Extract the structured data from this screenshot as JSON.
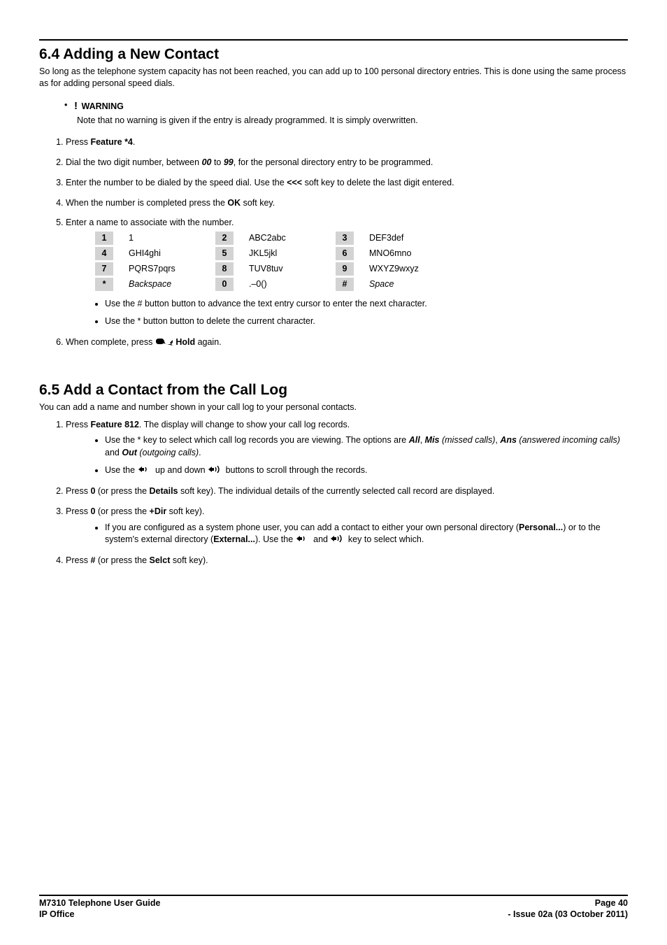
{
  "section64": {
    "heading": "6.4 Adding a New Contact",
    "intro": "So long as the telephone system capacity has not been reached, you can add up to 100 personal directory entries. This is done using the same process as for adding personal speed dials.",
    "warning_label": "WARNING",
    "warning_note": "Note that no warning is given if the entry is already programmed. It is simply overwritten.",
    "step1_a": "Press ",
    "step1_b": "Feature *4",
    "step1_c": ".",
    "step2_a": "Dial the two digit number, between ",
    "step2_b": "00",
    "step2_c": " to ",
    "step2_d": "99",
    "step2_e": ", for the personal directory entry to be programmed.",
    "step3_a": "Enter the number to be dialed by the speed dial.  Use the ",
    "step3_b": "<<<",
    "step3_c": " soft key to delete the last digit entered.",
    "step4_a": "When the number is completed press the ",
    "step4_b": "OK",
    "step4_c": " soft key.",
    "step5": "Enter a name to associate with the number.",
    "keypad": [
      {
        "k": "1",
        "v": "1",
        "i": false
      },
      {
        "k": "2",
        "v": "ABC2abc",
        "i": false
      },
      {
        "k": "3",
        "v": "DEF3def",
        "i": false
      },
      {
        "k": "4",
        "v": "GHI4ghi",
        "i": false
      },
      {
        "k": "5",
        "v": "JKL5jkl",
        "i": false
      },
      {
        "k": "6",
        "v": "MNO6mno",
        "i": false
      },
      {
        "k": "7",
        "v": "PQRS7pqrs",
        "i": false
      },
      {
        "k": "8",
        "v": "TUV8tuv",
        "i": false
      },
      {
        "k": "9",
        "v": "WXYZ9wxyz",
        "i": false
      },
      {
        "k": "*",
        "v": "Backspace",
        "i": true
      },
      {
        "k": "0",
        "v": ".–0()",
        "i": false
      },
      {
        "k": "#",
        "v": "Space",
        "i": true
      }
    ],
    "sub1": "Use the # button button to advance the text entry cursor to enter the next character.",
    "sub2": "Use the * button button to delete the current character.",
    "step6_a": "When complete, press ",
    "step6_b": " Hold",
    "step6_c": " again."
  },
  "section65": {
    "heading": "6.5 Add a Contact from the Call Log",
    "intro": "You can add a name and number shown in your call log to your personal contacts.",
    "step1_a": "Press ",
    "step1_b": "Feature 812",
    "step1_c": ". The display will change to show your call log records.",
    "sub1_a": "Use the * key to select which call log records you are viewing. The options are ",
    "sub1_all": "All",
    "sub1_b": ", ",
    "sub1_mis": "Mis",
    "sub1_mis_desc": " (missed calls)",
    "sub1_c": ", ",
    "sub1_ans": "Ans",
    "sub1_ans_desc": " (answered incoming calls)",
    "sub1_d": " and ",
    "sub1_out": "Out",
    "sub1_out_desc": " (outgoing calls)",
    "sub1_e": ".",
    "sub2_a": "Use the ",
    "sub2_b": " up and down ",
    "sub2_c": " buttons to scroll through the records.",
    "step2_a": "Press ",
    "step2_b": "0",
    "step2_c": " (or press the ",
    "step2_d": "Details",
    "step2_e": " soft key). The individual details of the currently selected call record are displayed.",
    "step3_a": "Press ",
    "step3_b": "0",
    "step3_c": " (or press the ",
    "step3_d": "+Dir",
    "step3_e": " soft key).",
    "sub3_a": "If you are configured as a system phone user, you can add a contact to either your own personal directory (",
    "sub3_personal": "Personal...",
    "sub3_b": ") or to the system's external directory (",
    "sub3_external": "External...",
    "sub3_c": "). Use the ",
    "sub3_d": " and ",
    "sub3_e": " key to select which.",
    "step4_a": "Press ",
    "step4_b": "#",
    "step4_c": " (or press the ",
    "step4_d": "Selct",
    "step4_e": " soft key)."
  },
  "footer": {
    "left1": "M7310 Telephone User Guide",
    "left2": "IP Office",
    "right1": "Page 40",
    "right2": "- Issue 02a (03 October 2011)"
  }
}
